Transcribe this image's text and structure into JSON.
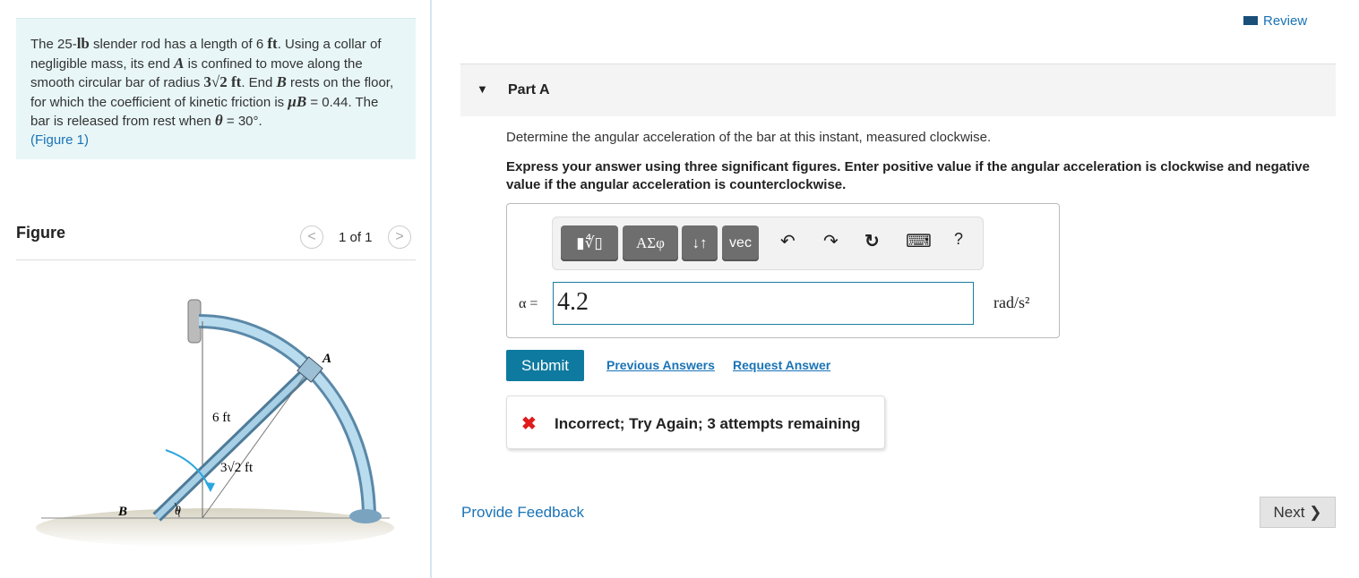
{
  "problem": {
    "p1": "The 25-",
    "lb": "lb",
    "p2": " slender rod has a length of 6 ",
    "ft": "ft",
    "p3": ". Using a collar of negligible mass, its end ",
    "A": "A",
    "p4": " is confined to move along the smooth circular bar of radius ",
    "r": "3√2",
    "ft2": " ft",
    "p5": ". End ",
    "B": "B",
    "p6": " rests on the floor, for which the coefficient of kinetic friction is ",
    "mu": "μB",
    "p7": " = 0.44. The bar is released from rest when ",
    "theta": "θ",
    "p8": " = 30°.",
    "figlink": "(Figure 1)"
  },
  "figure": {
    "heading": "Figure",
    "pager": "1 of 1",
    "prev": "<",
    "next": ">",
    "labels": {
      "A": "A",
      "B": "B",
      "theta": "θ",
      "len": "6 ft",
      "radius": "3√2 ft"
    }
  },
  "review": "Review",
  "part": {
    "title": "Part A",
    "question": "Determine the angular acceleration of the bar at this instant, measured clockwise.",
    "instructions": "Express your answer using three significant figures. Enter positive value if the angular acceleration is clockwise and negative value if the angular acceleration is counterclockwise."
  },
  "toolbar": {
    "templates": "▮∜▯",
    "greek": "ΑΣφ",
    "arrows": "↓↑",
    "vec": "vec",
    "undo": "↶",
    "redo": "↷",
    "reset": "↻",
    "keyboard": "⌨",
    "help": "?"
  },
  "answer": {
    "label": "α =",
    "value": "4.2",
    "unit": "rad/s²"
  },
  "actions": {
    "submit": "Submit",
    "previous": "Previous Answers",
    "request": "Request Answer"
  },
  "feedback": {
    "icon": "✖",
    "text": "Incorrect; Try Again; 3 attempts remaining"
  },
  "footer": {
    "provide_feedback": "Provide Feedback",
    "next": "Next ❯"
  },
  "colors": {
    "accent": "#0f7aa0",
    "error": "#e01b1b",
    "link": "#1a73b6"
  }
}
